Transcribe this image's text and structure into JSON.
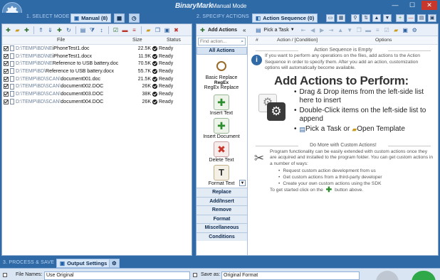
{
  "window": {
    "logo": "BinaryMark",
    "title": "- Manual Mode",
    "buttons": {
      "minimize": "—",
      "maximize": "☐",
      "close": "✕"
    }
  },
  "steps": {
    "select_mode": "1. SELECT MODE",
    "specify_actions": "2. SPECIFY ACTIONS",
    "process_save": "3. PROCESS & SAVE"
  },
  "tabs": {
    "manual": "Manual (8)",
    "action_sequence": "Action Sequence (0)",
    "output_settings": "Output Settings"
  },
  "file_list": {
    "headers": {
      "file": "File",
      "size": "Size",
      "status": "Status"
    },
    "rows": [
      {
        "path": "D:\\TEMP\\BD\\NE",
        "name": "iPhoneTest1.doc",
        "size": "22.5K",
        "status": "Ready"
      },
      {
        "path": "D:\\TEMP\\BD\\NE",
        "name": "iPhoneTest1.docx",
        "size": "11.9K",
        "status": "Ready"
      },
      {
        "path": "D:\\TEMP\\BD\\NE",
        "name": "Reference to USB battery.doc",
        "size": "70.5K",
        "status": "Ready"
      },
      {
        "path": "D:\\TEMP\\BD\\",
        "name": "Reference to USB battery.docx",
        "size": "55.7K",
        "status": "Ready"
      },
      {
        "path": "D:\\TEMP\\BD\\SCAN\\",
        "name": "document001.doc",
        "size": "21.5K",
        "status": "Ready"
      },
      {
        "path": "D:\\TEMP\\BD\\SCAN\\",
        "name": "document002.DOC",
        "size": "26K",
        "status": "Ready"
      },
      {
        "path": "D:\\TEMP\\BD\\SCAN\\",
        "name": "document003.DOC",
        "size": "38K",
        "status": "Ready"
      },
      {
        "path": "D:\\TEMP\\BD\\SCAN\\",
        "name": "document004.DOC",
        "size": "26K",
        "status": "Ready"
      }
    ]
  },
  "actions_toolbar": {
    "add_actions": "Add Actions",
    "collapse": "«",
    "pick_task": "Pick a Task"
  },
  "actions_panel": {
    "find_placeholder": "Find action...",
    "all_actions": "All Actions",
    "items": [
      {
        "label": "Basic Replace"
      },
      {
        "label": "RegEx Replace"
      },
      {
        "label": "Insert Text"
      },
      {
        "label": "Insert Document"
      },
      {
        "label": "Delete Text"
      },
      {
        "label": "Format Text"
      }
    ],
    "regex_sub": "RegEx",
    "categories": [
      "Replace",
      "Add/Insert",
      "Remove",
      "Format",
      "Miscellaneous",
      "Conditions"
    ]
  },
  "sequence": {
    "headers": {
      "num": "#",
      "action": "Action / [Condition]",
      "options": "Options"
    },
    "empty_title": "Action Sequence is Empty",
    "empty_text": "If you want to perform any operations on the files, add actions to the Action Sequence in order to specify them. After you add an action, customization options will automatically become available.",
    "big_title": "Add Actions to Perform:",
    "bullets": [
      "Drag & Drop items from the left-side list here to insert",
      "Double-Click items on the left-side list to append"
    ],
    "pick_a_task": "Pick a Task",
    "or": "or",
    "open_template": "Open Template",
    "custom_title": "Do More with Custom Actions!",
    "custom_text": "Program functionality can be easily extended with custom actions once they are acquired and installed to the program folder. You can get custom actions in a number of ways:",
    "custom_bullets": [
      "Request custom action development from us",
      "Get custom actions from a third-party developer",
      "Create your own custom actions using the SDK"
    ],
    "get_started_pre": "To get started click on the",
    "get_started_post": "button above."
  },
  "output": {
    "file_names_label": "File Names:",
    "file_names_value": "Use Original",
    "save_as_label": "Save as:",
    "save_as_value": "Original Format"
  },
  "colors": {
    "title_blue": "#2f6aa7",
    "accent_green": "#2d8c2d",
    "close_red": "#c8372b"
  }
}
